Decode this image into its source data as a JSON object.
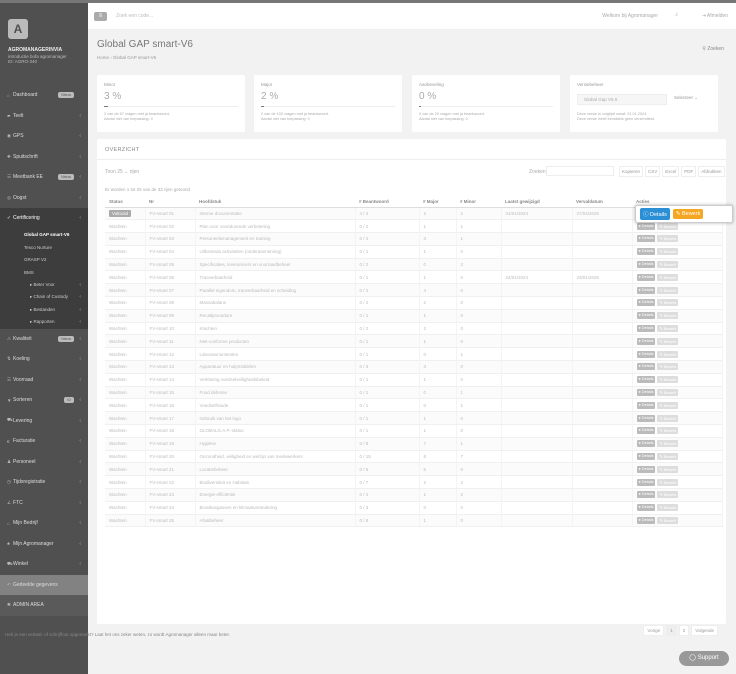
{
  "topbar": {
    "search_placeholder": "Zoek een code...",
    "welcome": "Welkom bij Agromanager",
    "logout": "Afmelden"
  },
  "org": {
    "name": "AGROMANAGERINVIA",
    "line1": "introductie bofa agromanager",
    "line2": "ID: AGRO-340"
  },
  "nav": [
    {
      "icon": "⌂",
      "label": "Dashboard",
      "badge": "Nieuw"
    },
    {
      "icon": "▰",
      "label": "Teelt",
      "chev": "‹"
    },
    {
      "icon": "◉",
      "label": "GPS",
      "chev": "‹"
    },
    {
      "icon": "✚",
      "label": "Spuitschrift",
      "chev": "‹"
    },
    {
      "icon": "☰",
      "label": "Meetbank EE",
      "badge": "Nieuw",
      "chev": "‹"
    },
    {
      "icon": "◎",
      "label": "Oogst",
      "chev": "‹"
    },
    {
      "icon": "✔",
      "label": "Certificering",
      "chev": "‹",
      "active": true
    }
  ],
  "subnav": [
    {
      "label": "Global GAP smart-V6",
      "cur": true
    },
    {
      "label": "Tesco Nurture"
    },
    {
      "label": "GRASP V2"
    },
    {
      "label": "BMS"
    },
    {
      "label": "▸ Beter Voor",
      "chev": "‹",
      "l2": true
    },
    {
      "label": "▸ Chain of Custody",
      "chev": "‹",
      "l2": true
    },
    {
      "label": "▸ Bestanden",
      "chev": "‹",
      "l2": true
    },
    {
      "label": "▸ Rapporten",
      "chev": "‹",
      "l2": true
    }
  ],
  "nav2": [
    {
      "icon": "⚠",
      "label": "Kwaliteit",
      "badge": "Nieuw",
      "chev": "‹"
    },
    {
      "icon": "⇅",
      "label": "Koeling",
      "chev": "‹"
    },
    {
      "icon": "☰",
      "label": "Voorraad",
      "chev": "‹"
    },
    {
      "icon": "▼",
      "label": "Sorteren",
      "badge": "V2",
      "chev": "‹"
    },
    {
      "icon": "⛟",
      "label": "Levering",
      "chev": "‹"
    },
    {
      "icon": "€",
      "label": "Facturatie",
      "chev": "‹"
    },
    {
      "icon": "♟",
      "label": "Personeel",
      "chev": "‹"
    },
    {
      "icon": "◷",
      "label": "Tijdsregistratie",
      "chev": "‹"
    },
    {
      "icon": "∠",
      "label": "FTC",
      "chev": "‹"
    },
    {
      "icon": "⌂",
      "label": "Mijn Bedrijf",
      "chev": "‹"
    },
    {
      "icon": "♣",
      "label": "Mijn Agromanager",
      "chev": "‹"
    },
    {
      "icon": "⛟",
      "label": "Winkel",
      "chev": "‹"
    },
    {
      "icon": "↶",
      "label": "Gedeelde gegevens",
      "ga": true
    },
    {
      "icon": "✱",
      "label": "ADMIN AREA",
      "admin": true
    }
  ],
  "page": {
    "title": "Global GAP smart-V6",
    "breadcrumb": "Home  ›  Global GAP smart-V6",
    "zoeken": "Zoeken"
  },
  "cards": [
    {
      "label": "Minor",
      "pct": "3 %",
      "fill": 0.03,
      "l1": "2 van de 67 vragen met ja beantwoord.",
      "l2": "Aantal niet van toepassing: 4"
    },
    {
      "label": "Major",
      "pct": "2 %",
      "fill": 0.02,
      "l1": "2 van de 102 vragen met ja beantwoord.",
      "l2": "Aantal niet van toepassing: 0"
    },
    {
      "label": "Aanbeveling",
      "pct": "0 %",
      "fill": 0,
      "l1": "0 van de 20 vragen met ja beantwoord.",
      "l2": "Aantal niet van toepassing: 0"
    }
  ],
  "version": {
    "label": "Versiebeheer",
    "value": "Global Gap V6.0",
    "button": "Selecteer ⌄",
    "l1": "Deze versie is volgtijdt vanaf: 01.01.2024.",
    "l2": "Deze versie heeft inmiddels geen verzendtest."
  },
  "overview": {
    "title": "OVERZICHT",
    "toon": "Toon  25  ⌄  rijen",
    "zoeken": "Zoeken:",
    "exports": [
      "Kopieren",
      "CSV",
      "Excel",
      "PDF",
      "Afdrukken"
    ],
    "info": "Er worden 1 tot 25 van de 33 rijen getoond",
    "columns": [
      "Status",
      "Nr",
      "Hoofdstuk",
      "# Beantwoord",
      "# Major",
      "# Minor",
      "Laatst gewijzigd",
      "Vervaldatum",
      "Acties"
    ]
  },
  "rows": [
    {
      "status": "Voltooid",
      "nr": "FV-smart 01",
      "h": "Interne documentatie",
      "b": "4 / 4",
      "maj": "2",
      "min": "2",
      "lw": "31/01/2024",
      "vd": "27/02/2026"
    },
    {
      "status": "Wachten",
      "nr": "FV-smart 02",
      "h": "Plan voor voortdurende verbetering",
      "b": "0 / 2",
      "maj": "1",
      "min": "1",
      "lw": "",
      "vd": ""
    },
    {
      "status": "Wachten",
      "nr": "FV-smart 03",
      "h": "Personeelsmanagement en training",
      "b": "0 / 4",
      "maj": "3",
      "min": "1",
      "lw": "",
      "vd": ""
    },
    {
      "status": "Wachten",
      "nr": "FV-smart 04",
      "h": "Uitbesteda activiteiten (onderaanneming)",
      "b": "0 / 1",
      "maj": "1",
      "min": "0",
      "lw": "",
      "vd": ""
    },
    {
      "status": "Wachten",
      "nr": "FV-smart 05",
      "h": "Specificaties, leveranciers en voorraadbeheer",
      "b": "0 / 2",
      "maj": "0",
      "min": "2",
      "lw": "",
      "vd": ""
    },
    {
      "status": "Wachten",
      "nr": "FV-smart 06",
      "h": "Traceerbaarheid",
      "b": "0 / 1",
      "maj": "1",
      "min": "0",
      "lw": "24/01/2024",
      "vd": "23/01/2026"
    },
    {
      "status": "Wachten",
      "nr": "FV-smart 07",
      "h": "Parallel eigendom, traceerbaarheid en scheiding",
      "b": "0 / 4",
      "maj": "4",
      "min": "0",
      "lw": "",
      "vd": ""
    },
    {
      "status": "Wachten",
      "nr": "FV-smart 08",
      "h": "Massabalans",
      "b": "0 / 2",
      "maj": "2",
      "min": "0",
      "lw": "",
      "vd": ""
    },
    {
      "status": "Wachten",
      "nr": "FV-smart 09",
      "h": "Recallprocedure",
      "b": "0 / 1",
      "maj": "1",
      "min": "0",
      "lw": "",
      "vd": ""
    },
    {
      "status": "Wachten",
      "nr": "FV-smart 10",
      "h": "Klachten",
      "b": "0 / 2",
      "maj": "2",
      "min": "0",
      "lw": "",
      "vd": ""
    },
    {
      "status": "Wachten",
      "nr": "FV-smart 11",
      "h": "Niet-conforme producten",
      "b": "0 / 1",
      "maj": "1",
      "min": "0",
      "lw": "",
      "vd": ""
    },
    {
      "status": "Wachten",
      "nr": "FV-smart 12",
      "h": "Laboratoriumtesten",
      "b": "0 / 1",
      "maj": "0",
      "min": "1",
      "lw": "",
      "vd": ""
    },
    {
      "status": "Wachten",
      "nr": "FV-smart 13",
      "h": "Apparatuur en hulpmiddelen",
      "b": "0 / 3",
      "maj": "3",
      "min": "0",
      "lw": "",
      "vd": ""
    },
    {
      "status": "Wachten",
      "nr": "FV-smart 14",
      "h": "Verklaring voedselveiligheidsbeleid",
      "b": "0 / 1",
      "maj": "1",
      "min": "0",
      "lw": "",
      "vd": ""
    },
    {
      "status": "Wachten",
      "nr": "FV-smart 15",
      "h": "Food defense",
      "b": "0 / 1",
      "maj": "0",
      "min": "1",
      "lw": "",
      "vd": ""
    },
    {
      "status": "Wachten",
      "nr": "FV-smart 16",
      "h": "Voedselfraude",
      "b": "0 / 1",
      "maj": "0",
      "min": "1",
      "lw": "",
      "vd": ""
    },
    {
      "status": "Wachten",
      "nr": "FV-smart 17",
      "h": "Gebruik van het logo",
      "b": "0 / 1",
      "maj": "1",
      "min": "0",
      "lw": "",
      "vd": ""
    },
    {
      "status": "Wachten",
      "nr": "FV-smart 18",
      "h": "GLOBALG.A.P.-status",
      "b": "0 / 1",
      "maj": "1",
      "min": "0",
      "lw": "",
      "vd": ""
    },
    {
      "status": "Wachten",
      "nr": "FV-smart 19",
      "h": "Hygiëne",
      "b": "0 / 8",
      "maj": "7",
      "min": "1",
      "lw": "",
      "vd": ""
    },
    {
      "status": "Wachten",
      "nr": "FV-smart 20",
      "h": "Gezondheid, veiligheid en welzijn van medewerkers",
      "b": "0 / 15",
      "maj": "8",
      "min": "7",
      "lw": "",
      "vd": ""
    },
    {
      "status": "Wachten",
      "nr": "FV-smart 21",
      "h": "Locatiebeheer",
      "b": "0 / 5",
      "maj": "5",
      "min": "0",
      "lw": "",
      "vd": ""
    },
    {
      "status": "Wachten",
      "nr": "FV-smart 22",
      "h": "Biodiversiteit en Habitats",
      "b": "0 / 7",
      "maj": "2",
      "min": "2",
      "lw": "",
      "vd": ""
    },
    {
      "status": "Wachten",
      "nr": "FV-smart 23",
      "h": "Energie-efficiëntie",
      "b": "0 / 4",
      "maj": "1",
      "min": "2",
      "lw": "",
      "vd": ""
    },
    {
      "status": "Wachten",
      "nr": "FV-smart 24",
      "h": "Broeikasgassen en klimaatverandering",
      "b": "0 / 3",
      "maj": "0",
      "min": "0",
      "lw": "",
      "vd": ""
    },
    {
      "status": "Wachten",
      "nr": "FV-smart 25",
      "h": "Afvalbeheer",
      "b": "0 / 8",
      "maj": "1",
      "min": "0",
      "lw": "",
      "vd": ""
    }
  ],
  "actions": {
    "details": "Details",
    "bewerk": "Bewerk"
  },
  "highlight": {
    "details": "ⓘ Details",
    "bewerk": "✎ Bewerk"
  },
  "pager": {
    "prev": "Vorige",
    "p1": "1",
    "p2": "2",
    "next": "Volgende"
  },
  "footer": "Heb je een vertaal- of schrijffout opgemerkt? Laat het ons zeker weten, zo wordt Agromanager alleen maar beter.",
  "support": "Support"
}
